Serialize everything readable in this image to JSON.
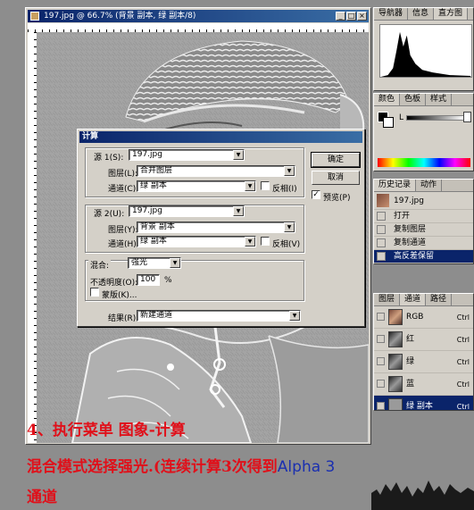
{
  "document": {
    "title": "197.jpg @ 66.7% (背景 副本, 绿 副本/8)",
    "window_buttons": [
      "_",
      "□",
      "×"
    ]
  },
  "histogram_palette": {
    "tabs": [
      "导航器",
      "信息",
      "直方图"
    ],
    "active_tab": "直方图"
  },
  "color_palette": {
    "tabs": [
      "颜色",
      "色板",
      "样式"
    ],
    "channel_label": "L"
  },
  "history_palette": {
    "tabs": [
      "历史记录",
      "动作"
    ],
    "snapshot": "197.jpg",
    "items": [
      "打开",
      "复制图层",
      "复制通道",
      "高反差保留"
    ],
    "selected_index": 3
  },
  "channels_palette": {
    "tabs": [
      "图层",
      "通道",
      "路径"
    ],
    "rows": [
      {
        "name": "RGB",
        "shortcut": "Ctrl"
      },
      {
        "name": "红",
        "shortcut": "Ctrl"
      },
      {
        "name": "绿",
        "shortcut": "Ctrl"
      },
      {
        "name": "蓝",
        "shortcut": "Ctrl"
      },
      {
        "name": "绿 副本",
        "shortcut": "Ctrl"
      }
    ],
    "selected_index": 4
  },
  "dialog": {
    "title": "计算",
    "source1": {
      "label": "源 1(S):",
      "value": "197.jpg",
      "layer_label": "图层(L):",
      "layer": "合并图层",
      "channel_label": "通道(C):",
      "channel": "绿 副本",
      "invert_label": "反相(I)",
      "invert_checked": false
    },
    "source2": {
      "label": "源 2(U):",
      "value": "197.jpg",
      "layer_label": "图层(Y):",
      "layer": "背景 副本",
      "channel_label": "通道(H):",
      "channel": "绿 副本",
      "invert_label": "反相(V)",
      "invert_checked": false
    },
    "blend": {
      "label": "混合:",
      "value": "强光",
      "opacity_label": "不透明度(O):",
      "opacity": "100",
      "opacity_unit": "%",
      "mask_label": "蒙版(K)...",
      "mask_checked": false
    },
    "result": {
      "label": "结果(R):",
      "value": "新建通道"
    },
    "ok_label": "确定",
    "cancel_label": "取消",
    "preview_label": "预览(P)",
    "preview_checked": true
  },
  "caption": {
    "line1": "4、执行菜单 图象-计算",
    "line2_red": "混合模式选择强光.(连续计算3次得到",
    "line2_blue": "Alpha 3",
    "line3": "通道"
  },
  "colors": {
    "title_bar": "#0a246a",
    "caption_red": "#e0101a",
    "caption_blue": "#1a2fb0",
    "selection": "#0a246a"
  }
}
